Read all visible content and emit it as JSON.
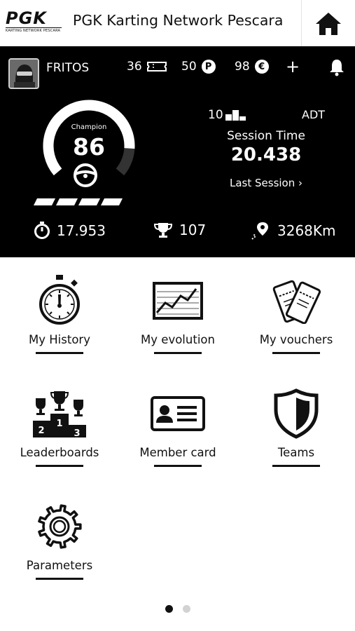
{
  "header": {
    "logo_text": "PGK",
    "logo_subtext": "KARTING NETWORK PESCARA",
    "title": "PGK Karting Network Pescara"
  },
  "profile": {
    "name": "FRITOS",
    "tickets": "36",
    "points": "50",
    "points_symbol": "P",
    "credits": "98",
    "credits_symbol": "€",
    "plus": "+"
  },
  "gauge": {
    "label": "Champion",
    "value": "86",
    "level_fraction": 0.86,
    "bars_filled": 4,
    "bars_total": 4
  },
  "session": {
    "rank": "10",
    "track": "ADT",
    "label": "Session Time",
    "time": "20.438",
    "last_session": "Last Session ›"
  },
  "stats": {
    "best_lap": "17.953",
    "trophies": "107",
    "distance": "3268Km"
  },
  "menu": {
    "items": [
      {
        "label": "My History",
        "icon": "stopwatch-icon"
      },
      {
        "label": "My evolution",
        "icon": "chart-icon"
      },
      {
        "label": "My vouchers",
        "icon": "vouchers-icon"
      },
      {
        "label": "Leaderboards",
        "icon": "podium-icon"
      },
      {
        "label": "Member card",
        "icon": "id-card-icon"
      },
      {
        "label": "Teams",
        "icon": "shield-icon"
      },
      {
        "label": "Parameters",
        "icon": "gear-icon"
      }
    ]
  },
  "pagination": {
    "pages": 2,
    "current": 1
  }
}
